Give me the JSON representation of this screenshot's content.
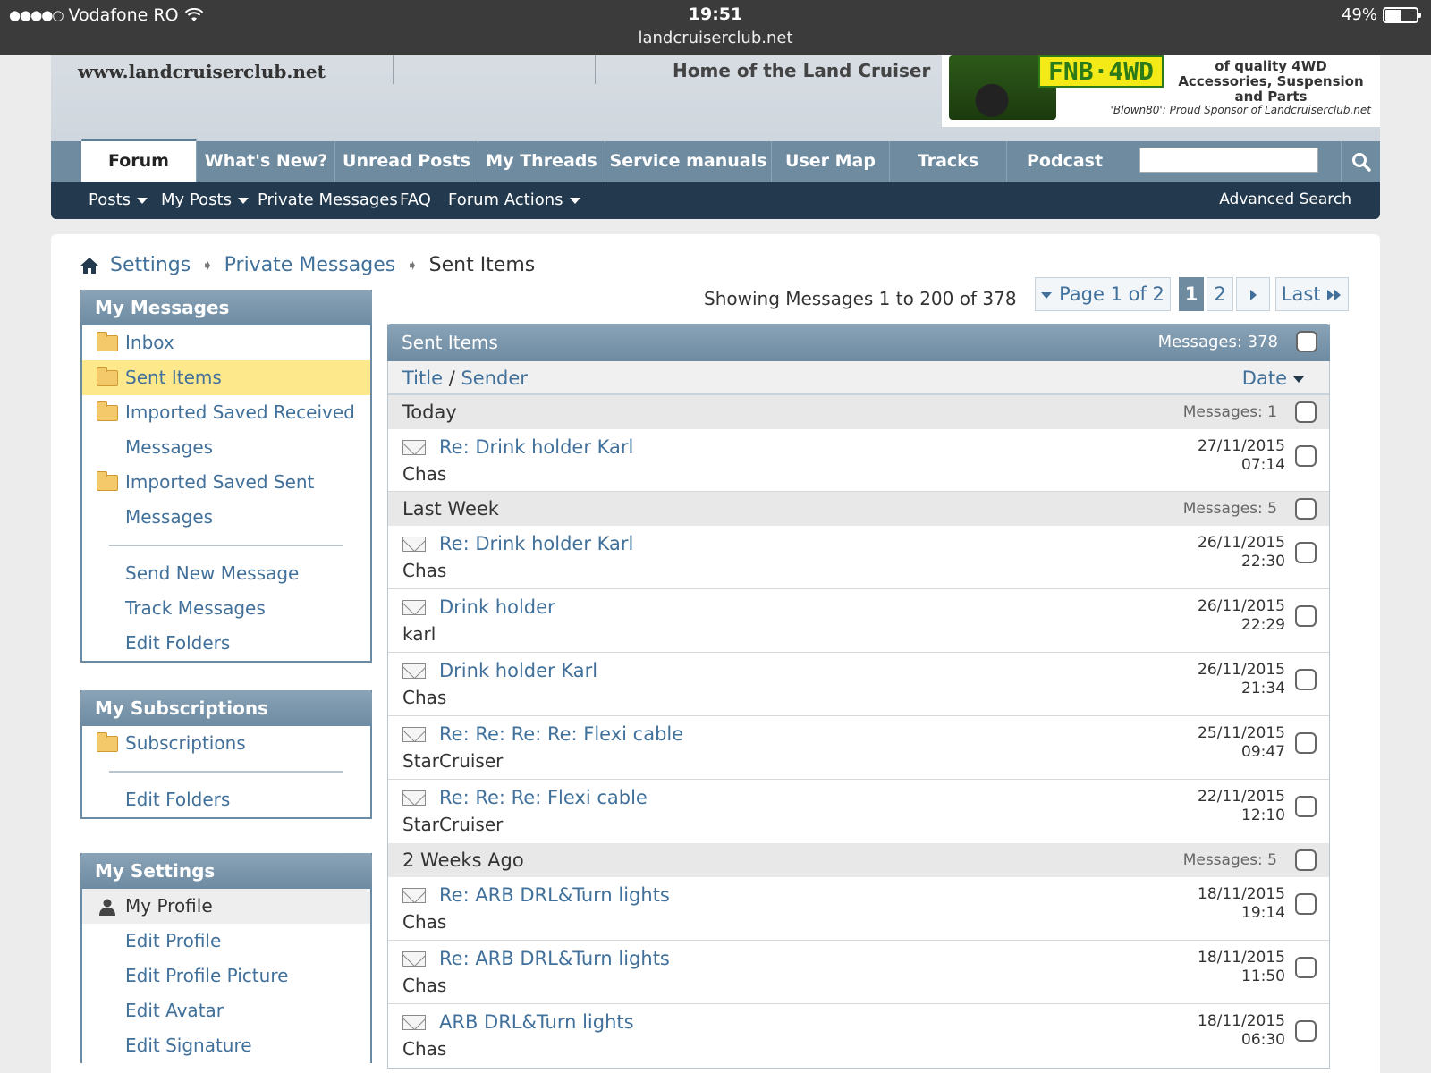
{
  "status": {
    "carrier": "Vodafone RO",
    "time": "19:51",
    "url": "landcruiserclub.net",
    "battery": "49%",
    "battery_level": 0.49
  },
  "banner": {
    "site": "www.landcruiserclub.net",
    "tagline": "Home of the Land Cruiser",
    "sponsor_plate": "FNB·4WD",
    "sponsor_text": "of quality 4WD Accessories, Suspension and Parts",
    "sponsor_caption": "'Blown80': Proud Sponsor of Landcruiserclub.net"
  },
  "nav": {
    "tabs": [
      "Forum",
      "What's New?",
      "Unread Posts",
      "My Threads",
      "Service manuals",
      "User Map",
      "Tracks",
      "Podcasts"
    ],
    "sub": [
      "Posts",
      "My Posts",
      "Private Messages",
      "FAQ",
      "Forum Actions"
    ],
    "advanced_search": "Advanced Search"
  },
  "breadcrumb": [
    "Settings",
    "Private Messages",
    "Sent Items"
  ],
  "sidebar": {
    "messages": {
      "title": "My Messages",
      "folders": [
        "Inbox",
        "Sent Items",
        "Imported Saved Received",
        "Messages",
        "Imported Saved Sent",
        "Messages"
      ],
      "links": [
        "Send New Message",
        "Track Messages",
        "Edit Folders"
      ]
    },
    "subscriptions": {
      "title": "My Subscriptions",
      "folders": [
        "Subscriptions"
      ],
      "links": [
        "Edit Folders"
      ]
    },
    "settings": {
      "title": "My Settings",
      "profile": "My Profile",
      "links": [
        "Edit Profile",
        "Edit Profile Picture",
        "Edit Avatar",
        "Edit Signature"
      ]
    }
  },
  "pagination": {
    "showing": "Showing Messages 1 to 200 of 378",
    "page_label": "Page 1 of 2",
    "pages": [
      "1",
      "2"
    ],
    "last": "Last"
  },
  "list": {
    "title": "Sent Items",
    "count": "Messages: 378",
    "col_title": "Title",
    "col_sep": "/",
    "col_sender": "Sender",
    "col_date": "Date",
    "groups": [
      {
        "name": "Today",
        "count": "Messages: 1",
        "messages": [
          {
            "title": "Re: Drink holder Karl",
            "sender": "Chas",
            "date": "27/11/2015",
            "time": "07:14"
          }
        ]
      },
      {
        "name": "Last Week",
        "count": "Messages: 5",
        "messages": [
          {
            "title": "Re: Drink holder Karl",
            "sender": "Chas",
            "date": "26/11/2015",
            "time": "22:30"
          },
          {
            "title": "Drink holder",
            "sender": "karl",
            "date": "26/11/2015",
            "time": "22:29"
          },
          {
            "title": "Drink holder Karl",
            "sender": "Chas",
            "date": "26/11/2015",
            "time": "21:34"
          },
          {
            "title": "Re: Re: Re: Re: Flexi cable",
            "sender": "StarCruiser",
            "date": "25/11/2015",
            "time": "09:47"
          },
          {
            "title": "Re: Re: Re: Flexi cable",
            "sender": "StarCruiser",
            "date": "22/11/2015",
            "time": "12:10"
          }
        ]
      },
      {
        "name": "2 Weeks Ago",
        "count": "Messages: 5",
        "messages": [
          {
            "title": "Re: ARB DRL&Turn lights",
            "sender": "Chas",
            "date": "18/11/2015",
            "time": "19:14"
          },
          {
            "title": "Re: ARB DRL&Turn lights",
            "sender": "Chas",
            "date": "18/11/2015",
            "time": "11:50"
          },
          {
            "title": "ARB DRL&Turn lights",
            "sender": "Chas",
            "date": "18/11/2015",
            "time": "06:30"
          }
        ]
      }
    ]
  }
}
